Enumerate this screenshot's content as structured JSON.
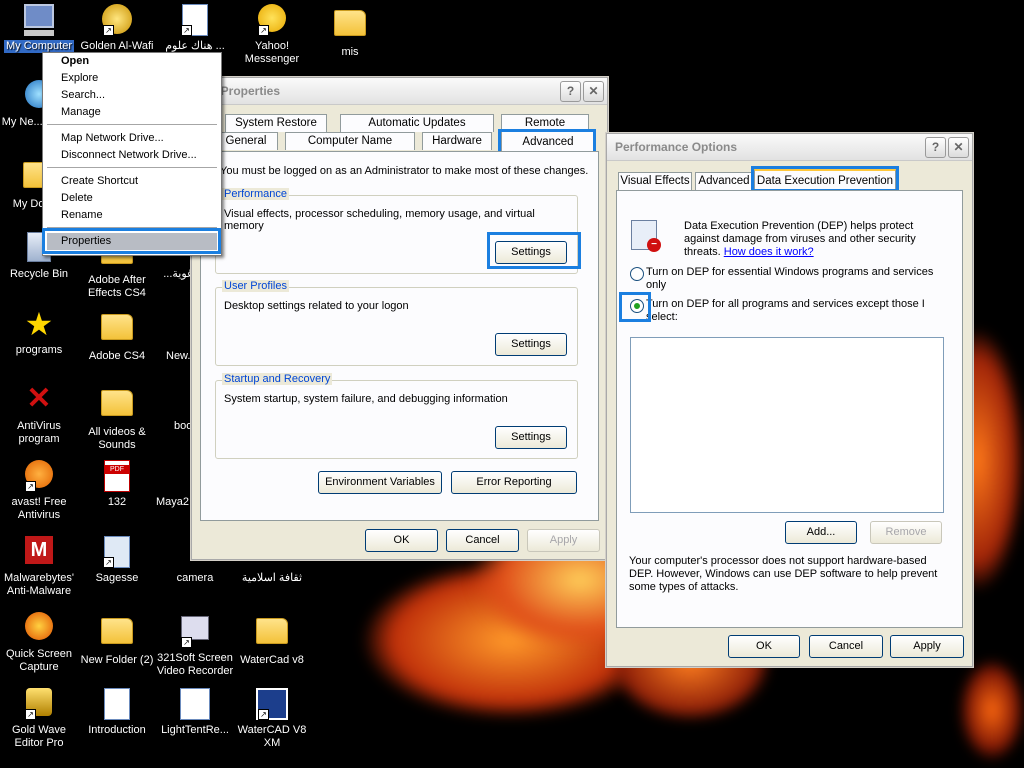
{
  "desktop": {
    "icons": [
      {
        "label": "My Computer"
      },
      {
        "label": "Golden Al-Wafi"
      },
      {
        "label": "هناك علوم ..."
      },
      {
        "label": "Yahoo! Messenger"
      },
      {
        "label": "mis"
      },
      {
        "label": "My Ne... Plac..."
      },
      {
        "label": "My Docu..."
      },
      {
        "label": "Recycle Bin"
      },
      {
        "label": "Adobe After Effects CS4"
      },
      {
        "label": "...غوية"
      },
      {
        "label": "programs"
      },
      {
        "label": "Adobe CS4"
      },
      {
        "label": "New..."
      },
      {
        "label": "AntiVirus program"
      },
      {
        "label": "All videos & Sounds"
      },
      {
        "label": "boo..."
      },
      {
        "label": "avast! Free Antivirus"
      },
      {
        "label": "132"
      },
      {
        "label": "Maya2..."
      },
      {
        "label": "Malwarebytes' Anti-Malware"
      },
      {
        "label": "Sagesse"
      },
      {
        "label": "camera"
      },
      {
        "label": "ثقافة اسلامية"
      },
      {
        "label": "Quick Screen Capture"
      },
      {
        "label": "New Folder (2)"
      },
      {
        "label": "321Soft Screen Video Recorder"
      },
      {
        "label": "WaterCad v8"
      },
      {
        "label": "Gold Wave Editor Pro"
      },
      {
        "label": "Introduction"
      },
      {
        "label": "LightTentRe..."
      },
      {
        "label": "WaterCAD V8 XM"
      }
    ]
  },
  "context_menu": {
    "items": [
      "Open",
      "Explore",
      "Search...",
      "Manage",
      "Map Network Drive...",
      "Disconnect Network Drive...",
      "Create Shortcut",
      "Delete",
      "Rename",
      "Properties"
    ]
  },
  "system_properties": {
    "title": "em Properties",
    "tabs_top": [
      "System Restore",
      "Automatic Updates",
      "Remote"
    ],
    "tabs_bottom": [
      "General",
      "Computer Name",
      "Hardware",
      "Advanced"
    ],
    "admin_note": "You must be logged on as an Administrator to make most of these changes.",
    "performance": {
      "label": "Performance",
      "desc": "Visual effects, processor scheduling, memory usage, and virtual memory",
      "button": "Settings"
    },
    "user_profiles": {
      "label": "User Profiles",
      "desc": "Desktop settings related to your logon",
      "button": "Settings"
    },
    "startup": {
      "label": "Startup and Recovery",
      "desc": "System startup, system failure, and debugging information",
      "button": "Settings"
    },
    "env_button": "Environment Variables",
    "error_button": "Error Reporting",
    "ok": "OK",
    "cancel": "Cancel",
    "apply": "Apply",
    "help": "?",
    "close": "✕"
  },
  "performance_options": {
    "title": "Performance Options",
    "tabs": [
      "Visual Effects",
      "Advanced",
      "Data Execution Prevention"
    ],
    "dep_info_1": "Data Execution Prevention (DEP) helps protect",
    "dep_info_2": "against damage from viruses and other security",
    "dep_info_3": "threats.",
    "how_link": "How does it work?",
    "radio1_line1": "Turn on DEP for essential Windows programs and services",
    "radio1_line2": "only",
    "radio2_line1": "Turn on DEP for all programs and services except those I",
    "radio2_line2": "select:",
    "add": "Add...",
    "remove": "Remove",
    "note_1": "Your computer's processor does not support hardware-based",
    "note_2": "DEP. However, Windows can use DEP software to help prevent",
    "note_3": "some types of attacks.",
    "ok": "OK",
    "cancel": "Cancel",
    "apply": "Apply",
    "help": "?",
    "close": "✕"
  },
  "colors": {
    "highlight": "#1b7fe0",
    "xp_face": "#ece9d8",
    "link": "#0000ff",
    "group_label": "#0046d5"
  }
}
